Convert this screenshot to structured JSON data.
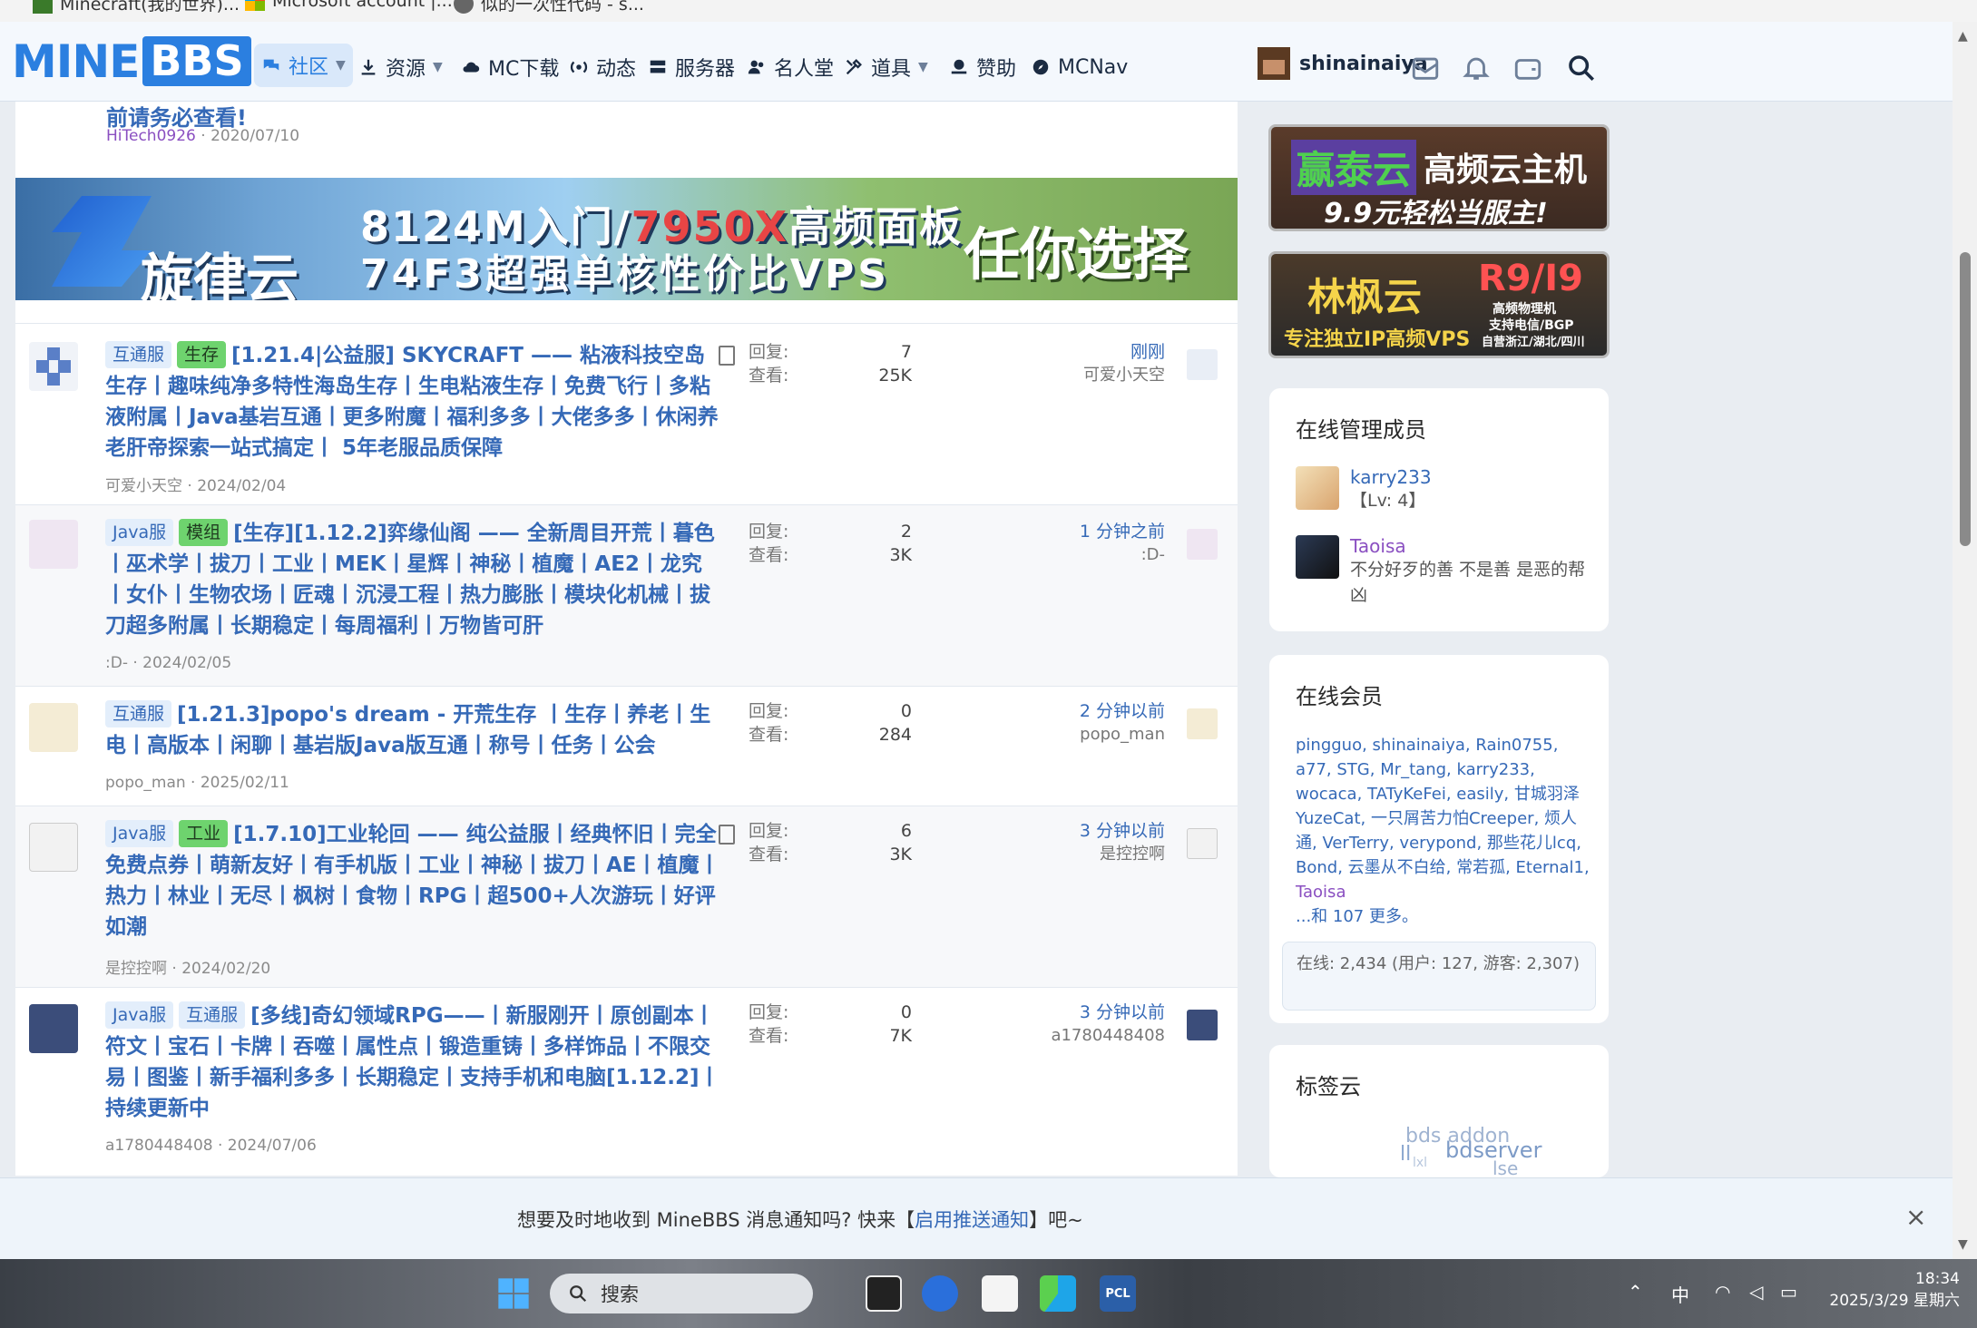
{
  "bookmarks": [
    {
      "label": "Minecraft(我的世界)..."
    },
    {
      "label": "Microsoft account |..."
    },
    {
      "label": "似的一次性代码 - s..."
    }
  ],
  "nav": {
    "logo_left": "MINE",
    "logo_right": "BBS",
    "items": [
      {
        "label": "社区"
      },
      {
        "label": "资源"
      },
      {
        "label": "MC下载"
      },
      {
        "label": "动态"
      },
      {
        "label": "服务器"
      },
      {
        "label": "名人堂"
      },
      {
        "label": "道具"
      },
      {
        "label": "赞助"
      },
      {
        "label": "MCNav"
      }
    ],
    "username": "shinainaiya"
  },
  "prev_thread": {
    "title": "前请务必查看!",
    "author": "HiTech0926",
    "date": "2020/07/10"
  },
  "banner": {
    "line1_a": "8124M入门/",
    "line1_b": "7950X",
    "line1_c": "高频面板",
    "brand": "旋律云",
    "line2": "74F3超强单核性价比VPS",
    "slogan": "任你选择"
  },
  "threads": [
    {
      "tags": [
        {
          "label": "互通服",
          "color": "blue"
        },
        {
          "label": "生存",
          "color": "green"
        }
      ],
      "title": "[1.21.4|公益服] SKYCRAFT —— 粘液科技空岛生存丨趣味纯净多特性海岛生存丨生电粘液生存丨免费飞行丨多粘液附属丨Java基岩互通丨更多附魔丨福利多多丨大佬多多丨休闲养老肝帝探索一站式搞定丨 5年老服品质保障",
      "author": "可爱小天空",
      "date": "2024/02/04",
      "reply_label": "回复:",
      "view_label": "查看:",
      "replies": "7",
      "views": "25K",
      "last_when": "刚刚",
      "last_who": "可爱小天空"
    },
    {
      "tags": [
        {
          "label": "Java服",
          "color": "blue"
        },
        {
          "label": "模组",
          "color": "green"
        }
      ],
      "title": "[生存][1.12.2]弈缘仙阁 —— 全新周目开荒丨暮色丨巫术学丨拔刀丨工业丨MEK丨星辉丨神秘丨植魔丨AE2丨龙究丨女仆丨生物农场丨匠魂丨沉浸工程丨热力膨胀丨模块化机械丨拔刀超多附属丨长期稳定丨每周福利丨万物皆可肝",
      "author": ":D-",
      "date": "2024/02/05",
      "reply_label": "回复:",
      "view_label": "查看:",
      "replies": "2",
      "views": "3K",
      "last_when": "1 分钟之前",
      "last_who": ":D-"
    },
    {
      "tags": [
        {
          "label": "互通服",
          "color": "blue"
        }
      ],
      "title": "[1.21.3]popo's dream - 开荒生存 丨生存丨养老丨生电丨高版本丨闲聊丨基岩版Java版互通丨称号丨任务丨公会",
      "author": "popo_man",
      "date": "2025/02/11",
      "reply_label": "回复:",
      "view_label": "查看:",
      "replies": "0",
      "views": "284",
      "last_when": "2 分钟以前",
      "last_who": "popo_man"
    },
    {
      "tags": [
        {
          "label": "Java服",
          "color": "blue"
        },
        {
          "label": "工业",
          "color": "green"
        }
      ],
      "title": "[1.7.10]工业轮回 —— 纯公益服丨经典怀旧丨完全免费点券丨萌新友好丨有手机版丨工业丨神秘丨拔刀丨AE丨植魔丨热力丨林业丨无尽丨枫树丨食物丨RPG丨超500+人次游玩丨好评如潮",
      "author": "是控控啊",
      "date": "2024/02/20",
      "reply_label": "回复:",
      "view_label": "查看:",
      "replies": "6",
      "views": "3K",
      "last_when": "3 分钟以前",
      "last_who": "是控控啊"
    },
    {
      "tags": [
        {
          "label": "Java服",
          "color": "blue"
        },
        {
          "label": "互通服",
          "color": "blue"
        }
      ],
      "title": "[多线]奇幻领域RPG——丨新服刚开丨原创副本丨符文丨宝石丨卡牌丨吞噬丨属性点丨锻造重铸丨多样饰品丨不限交易丨图鉴丨新手福利多多丨长期稳定丨支持手机和电脑[1.12.2]丨持续更新中",
      "author": "a1780448408",
      "date": "2024/07/06",
      "reply_label": "回复:",
      "view_label": "查看:",
      "replies": "0",
      "views": "7K",
      "last_when": "3 分钟以前",
      "last_who": "a1780448408"
    }
  ],
  "ads": {
    "ad1_brand": "赢泰云",
    "ad1_title": "高频云主机",
    "ad1_sub": "9.9元轻松当服主!",
    "ad2_brand": "林枫云",
    "ad2_model": "R9/I9",
    "ad2_sub": "专注独立IP高频VPS",
    "ad2_note1": "高频物理机",
    "ad2_note2": "支持电信/BGP",
    "ad2_note3": "自营浙江/湖北/四川"
  },
  "staff_card": {
    "title": "在线管理成员",
    "members": [
      {
        "name": "karry233",
        "desc": "【Lv: 4】"
      },
      {
        "name": "Taoisa",
        "desc": "不分好歹的善 不是善 是恶的帮凶"
      }
    ]
  },
  "members_card": {
    "title": "在线会员",
    "list": "pingguo, shinainaiya, Rain0755, a77, STG, Mr_tang, karry233, wocaca, TATyKeFei, easily, 甘城羽泽 YuzeCat, 一只屑苦力怕Creeper, 烦人通, VerTerry, verypond, 那些花儿lcq, Bond, 云墨从不白给, 常若孤, Eternal1, ",
    "purple_name": "Taoisa",
    "more": "...和 107 更多。",
    "stats": "在线: 2,434 (用户: 127, 游客: 2,307)"
  },
  "tag_cloud": {
    "title": "标签云",
    "words": [
      "bds addon",
      "bdserver",
      "ll",
      "lxl",
      "lse"
    ]
  },
  "notification": {
    "before": "想要及时地收到 MineBBS 消息通知吗? 快来【",
    "link": "启用推送通知",
    "after": "】吧~",
    "close": "×"
  },
  "taskbar": {
    "search_placeholder": "搜索",
    "time": "18:34",
    "date": "2025/3/29 星期六",
    "ime": "中",
    "pcl": "PCL"
  }
}
